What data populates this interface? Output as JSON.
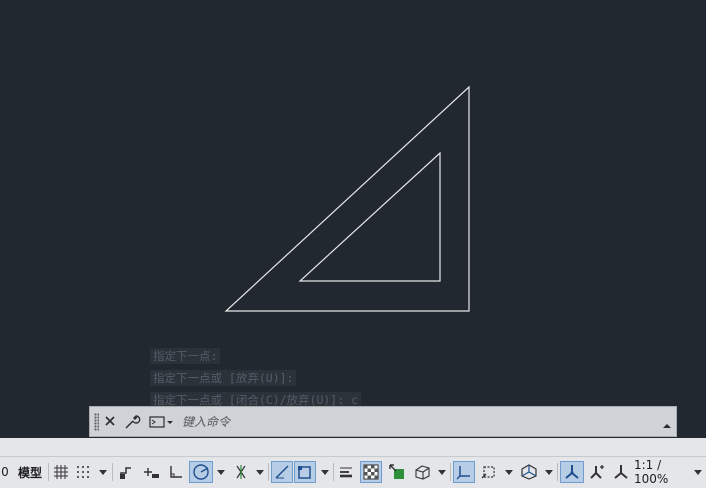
{
  "app": {
    "command_history": [
      "指定下一点:",
      "指定下一点或 [放弃(U)]:",
      "指定下一点或 [闭合(C)/放弃(U)]: c"
    ]
  },
  "command_line": {
    "placeholder": "键入命令",
    "icons": [
      "grip-handle",
      "close-icon",
      "customize-wrench-icon",
      "recent-commands-icon",
      "expand-history-icon"
    ]
  },
  "drawing": {
    "stroke_color": "#e8e8e8",
    "background_color": "#212830",
    "shapes": [
      "outer-triangle",
      "inner-triangle"
    ]
  },
  "status_bar": {
    "coordinate_fragment": "0",
    "model_label": "模型",
    "scale_label": "1:1 / 100%",
    "active_color": "#b7cde6",
    "tools": [
      "grid-icon",
      "snap-icon",
      "infer-constraints-icon",
      "dynamic-input-icon",
      "ortho-icon",
      "polar-tracking-icon",
      "isodraft-icon",
      "object-snap-tracking-icon",
      "object-snap-icon",
      "lineweight-icon",
      "transparency-icon",
      "selection-cycling-icon",
      "3d-object-snap-icon",
      "dynamic-ucs-icon",
      "selection-filter-icon",
      "gizmo-icon",
      "annotation-visibility-icon",
      "auto-scale-icon",
      "annotation-scale-icon"
    ]
  }
}
